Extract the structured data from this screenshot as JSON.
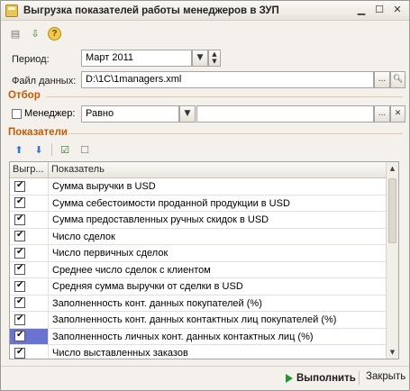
{
  "window": {
    "title": "Выгрузка показателей работы менеджеров в ЗУП"
  },
  "form": {
    "period_label": "Период:",
    "period_value": "Март 2011",
    "file_label": "Файл данных:",
    "file_value": "D:\\1C\\1managers.xml",
    "filter_section": "Отбор",
    "manager_label": "Менеджер:",
    "manager_checked": false,
    "condition_value": "Равно",
    "manager_value": ""
  },
  "indicators": {
    "section_title": "Показатели",
    "columns": [
      "Выгр...",
      "Показатель"
    ],
    "rows": [
      {
        "checked": true,
        "name": "Сумма выручки в USD"
      },
      {
        "checked": true,
        "name": "Сумма себестоимости проданной продукции в USD"
      },
      {
        "checked": true,
        "name": "Сумма предоставленных ручных скидок в USD"
      },
      {
        "checked": true,
        "name": "Число сделок"
      },
      {
        "checked": true,
        "name": "Число первичных сделок"
      },
      {
        "checked": true,
        "name": "Среднее число сделок с клиентом"
      },
      {
        "checked": true,
        "name": "Средняя сумма выручки от сделки в USD"
      },
      {
        "checked": true,
        "name": "Заполненность конт. данных покупателей (%)"
      },
      {
        "checked": true,
        "name": "Заполненность конт. данных контактных лиц покупателей (%)"
      },
      {
        "checked": true,
        "name": "Заполненность личных конт. данных контактных лиц (%)",
        "selected": true
      },
      {
        "checked": true,
        "name": "Число выставленных заказов"
      }
    ]
  },
  "buttons": {
    "run": "Выполнить",
    "close": "Закрыть"
  },
  "icons": {
    "window": "app-icon",
    "minimize": "minimize-icon",
    "restore": "restore-icon",
    "close": "close-icon"
  },
  "colors": {
    "section": "#c25a06",
    "selection": "#6a73cf",
    "run_arrow": "#1f9a2e"
  }
}
